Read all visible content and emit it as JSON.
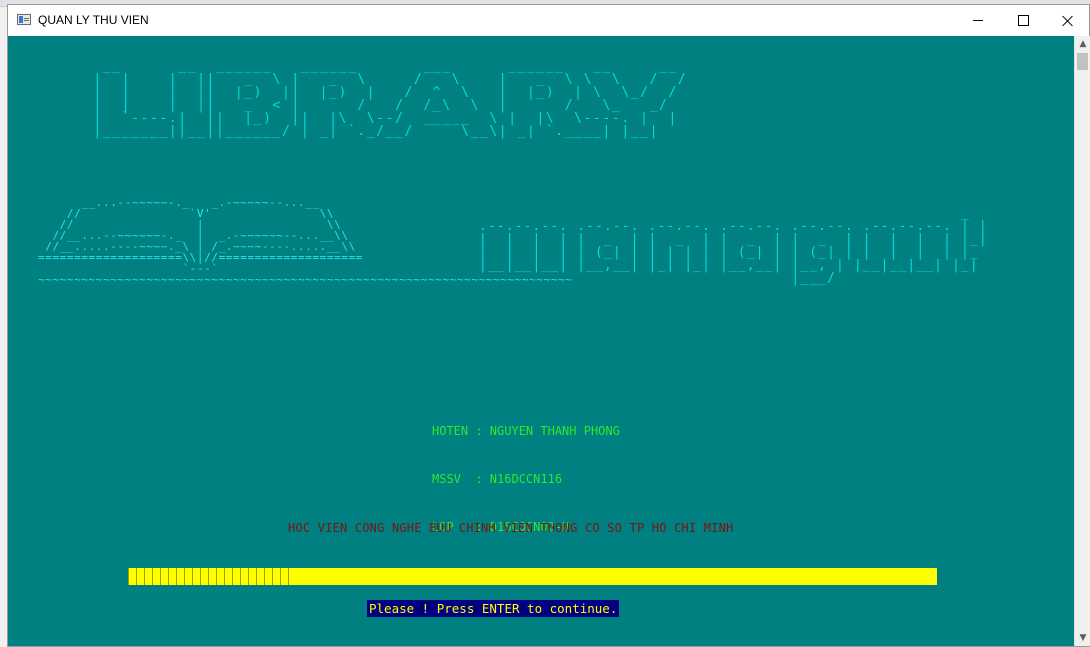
{
  "window": {
    "title": "QUAN LY THU VIEN",
    "controls": {
      "minimize": "minimize",
      "maximize": "maximize",
      "close": "close"
    }
  },
  "banner": {
    "library_ascii": "  __      __  ______   ______       ___      ______   __     __\n |  |    |  ||   _  \\ |   _  \\     /   \\    |   _  \\ \\  \\   /  /\n |  |    |  ||  |_)  ||  |_)  |   /  ^  \\   |  |_)  | \\  \\_/  /\n |  |    |  ||   _  < |      /   /  /_\\  \\  |      /   \\_   _/\n |  `----.|  ||  |_)  ||  |\\  \\--/  _____  \\ |  |\\  \\----. |  |\n |_______||__||______/ | _| `._/__/     \\__\\| _| `.____| |__|",
    "book_ascii": "      __...--~~~~~-._   _.-~~~~~--...__\n    //               `V'               \\\\\n   //                 |                 \\\\\n  //__...--~~~~~~-._  |  _.-~~~~~~--...__\\\\\n //__.....----~~~~._\\ | /_.~~~~----.....__\\\\\n====================\\\\|//====================\n                    `---`\n~~~~~~~~~~~~~~~~~~~~~~~~~~~~~~~~~~~~~~~~~~~~~~~~~~~~~~~~~~~~~~~~~~~~~~~~~~",
    "management_ascii": "                                                       _\n .--.--.--. .--.--. .--.--. .--.--. .--.--. .--.--.--. | |\n |  |  |  | |  _  | |  _  | |  _  | |  _  | |  |  |  | |_|\n |  |  |  | | (_| | | | | | | (_| | | (_| | |  |  |  | |_\n |__|__|__| |__,__| |_| |_| |__,__| |__, | |__|__|__| |_|\n                                    |___/"
  },
  "student_info": {
    "hoten_line": "HOTEN : NGUYEN THANH PHONG",
    "mssv_line": "MSSV  : N16DCCN116",
    "lop_line": "LOP   : D16CQCN02-N"
  },
  "school": "HOC VIEN CONG NGHE BUU CHINH VIEN THONG CO SO TP HO CHI MINH",
  "progress": {
    "fraction": 0.2
  },
  "prompt": "Please ! Press ENTER to continue.",
  "colors": {
    "console_bg": "#008080",
    "ascii_cyan": "#00dede",
    "info_green": "#2ee82e",
    "school_red": "#7a1414",
    "progress_yellow": "#ffff00",
    "prompt_bg": "#000080",
    "prompt_fg": "#ffff00"
  }
}
